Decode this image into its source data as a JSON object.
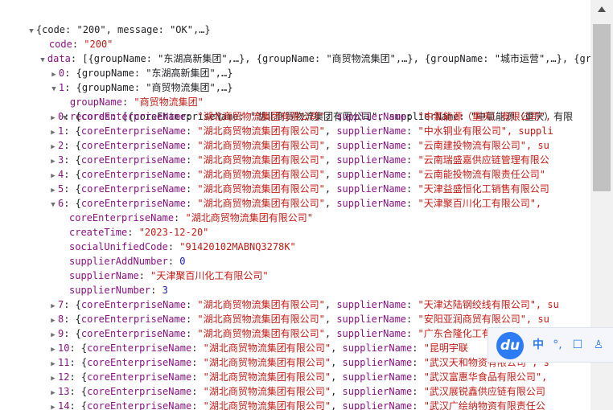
{
  "root": {
    "summary": "{code: \"200\", message: \"OK\",…}"
  },
  "code": {
    "key": "code",
    "value": "\"200\""
  },
  "data": {
    "key": "data",
    "summary": "[{groupName: \"东湖高新集团\",…}, {groupName: \"商贸物流集团\",…}, {groupName: \"城市运营\",…}, {gro"
  },
  "groups": [
    {
      "index": "0",
      "summary": "{groupName: \"东湖高新集团\",…}"
    },
    {
      "index": "1",
      "summary": "{groupName: \"商贸物流集团\",…}"
    }
  ],
  "group1": {
    "groupName_key": "groupName",
    "groupName_value": "\"商贸物流集团\"",
    "records_key": "records",
    "records_summary": "[{coreEnterpriseName: \"湖北商贸物流集团有限公司\", supplierName: \"中氯能源（重庆）有限"
  },
  "records": [
    {
      "index": "0",
      "supplier": "\"中氯能源（重庆）有限公司\","
    },
    {
      "index": "1",
      "supplier": "\"中水铜业有限公司\", suppli"
    },
    {
      "index": "2",
      "supplier": "\"云南建投物流有限公司\", su"
    },
    {
      "index": "3",
      "supplier": "\"云南瑞盛嘉供应链管理有限公"
    },
    {
      "index": "4",
      "supplier": "\"云南能投物流有限责任公司\""
    },
    {
      "index": "5",
      "supplier": "\"天津益盛恒化工销售有限公司"
    },
    {
      "index": "6",
      "supplier": "\"天津聚百川化工有限公司\","
    }
  ],
  "record_prefix": {
    "core_key": "coreEnterpriseName",
    "core_value": "\"湖北商贸物流集团有限公司\"",
    "supplier_key": "supplierName"
  },
  "record6": [
    {
      "key": "coreEnterpriseName",
      "value": "\"湖北商贸物流集团有限公司\"",
      "type": "s"
    },
    {
      "key": "createTime",
      "value": "\"2023-12-20\"",
      "type": "s"
    },
    {
      "key": "socialUnifiedCode",
      "value": "\"91420102MABNQ3278K\"",
      "type": "s"
    },
    {
      "key": "supplierAddNumber",
      "value": "0",
      "type": "n"
    },
    {
      "key": "supplierName",
      "value": "\"天津聚百川化工有限公司\"",
      "type": "s"
    },
    {
      "key": "supplierNumber",
      "value": "3",
      "type": "n"
    }
  ],
  "records_after": [
    {
      "index": "7",
      "supplier": "\"天津达陆钢绞线有限公司\", su"
    },
    {
      "index": "8",
      "supplier": "\"安阳亚润商贸有限公司\", su"
    },
    {
      "index": "9",
      "supplier": "\"广东合隆化工有限公司\""
    },
    {
      "index": "10",
      "supplier": "\"昆明宇联"
    },
    {
      "index": "11",
      "supplier": "\"武汉天和物资有限公司\", s"
    },
    {
      "index": "12",
      "supplier": "\"武汉富惠华食品有限公司\","
    },
    {
      "index": "13",
      "supplier": "\"武汉展锐鑫供应链有限公司"
    },
    {
      "index": "14",
      "supplier": "\"武汉广绘纳物资有限责任公"
    }
  ],
  "ime": {
    "logo": "du",
    "lang": "中",
    "punct": "°,",
    "toolbox": "☐",
    "user": "♙"
  },
  "colors": {
    "key": "#881280",
    "string": "#c41a16",
    "number": "#1a1aa6",
    "ime_blue": "#2d7cf6"
  }
}
